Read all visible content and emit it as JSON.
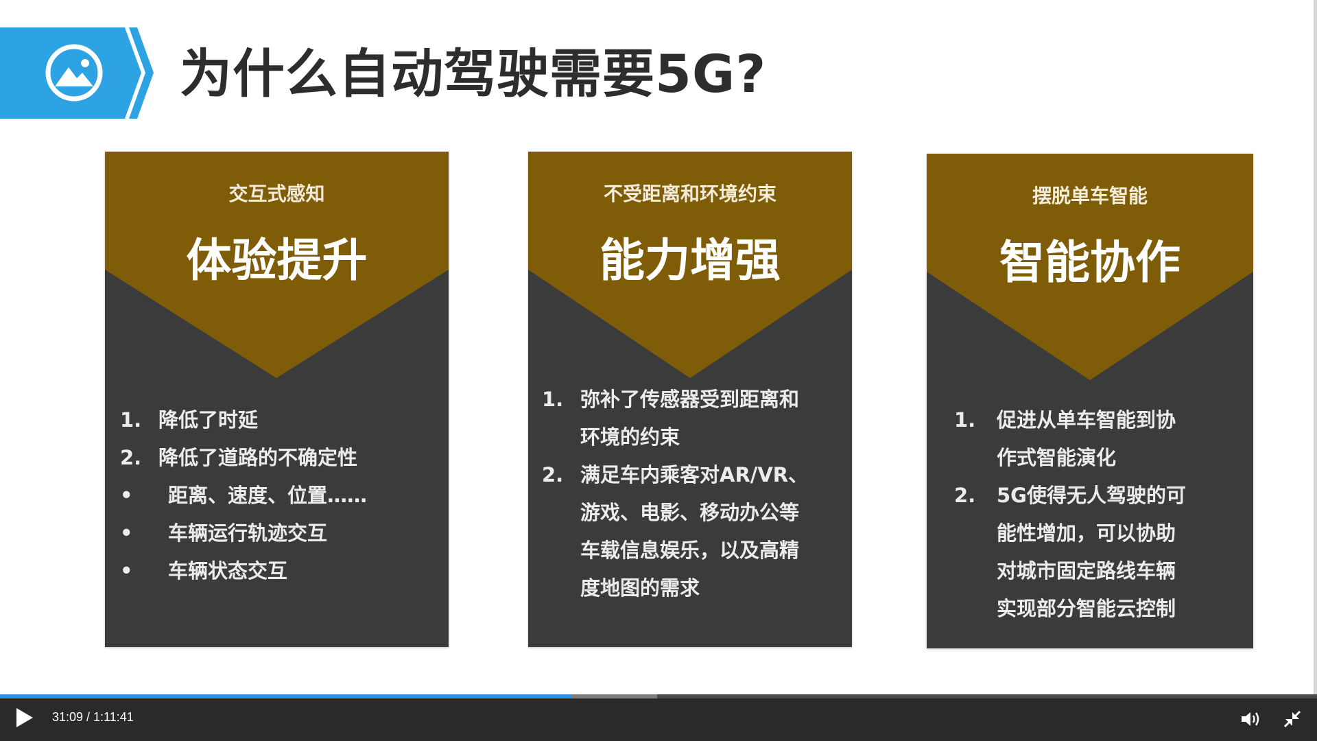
{
  "slide": {
    "title": "为什么自动驾驶需要5G?",
    "icon": "image-icon",
    "colors": {
      "banner_blue": "#2ea3e3",
      "card_gold": "#7f5d08",
      "card_dark": "#3b3b3b"
    },
    "cards": [
      {
        "subtitle": "交互式感知",
        "heading": "体验提升",
        "items": [
          {
            "marker": "1.",
            "text": "降低了时延"
          },
          {
            "marker": "2.",
            "text": "降低了道路的不确定性"
          },
          {
            "marker": "•",
            "text": "距离、速度、位置……"
          },
          {
            "marker": "•",
            "text": "车辆运行轨迹交互"
          },
          {
            "marker": "•",
            "text": "车辆状态交互"
          }
        ]
      },
      {
        "subtitle": "不受距离和环境约束",
        "heading": "能力增强",
        "items": [
          {
            "marker": "1.",
            "lines": [
              "弥补了传感器受到距离和",
              "环境的约束"
            ]
          },
          {
            "marker": "2.",
            "lines": [
              "满足车内乘客对AR/VR、",
              "游戏、电影、移动办公等",
              "车载信息娱乐，以及高精",
              "度地图的需求"
            ]
          }
        ]
      },
      {
        "subtitle": "摆脱单车智能",
        "heading": "智能协作",
        "items": [
          {
            "marker": "1.",
            "lines": [
              "促进从单车智能到协",
              "作式智能演化"
            ]
          },
          {
            "marker": "2.",
            "lines": [
              "5G使得无人驾驶的可",
              "能性增加，可以协助",
              "对城市固定路线车辆",
              "实现部分智能云控制"
            ]
          }
        ]
      }
    ]
  },
  "player": {
    "time": "31:09 / 1:11:41",
    "progress": 0.4345,
    "buffered": 0.4987,
    "play_icon": "play-icon",
    "volume_icon": "volume-icon",
    "exit_fullscreen_icon": "exit-fullscreen-icon",
    "accent": "#2f8fe0"
  }
}
